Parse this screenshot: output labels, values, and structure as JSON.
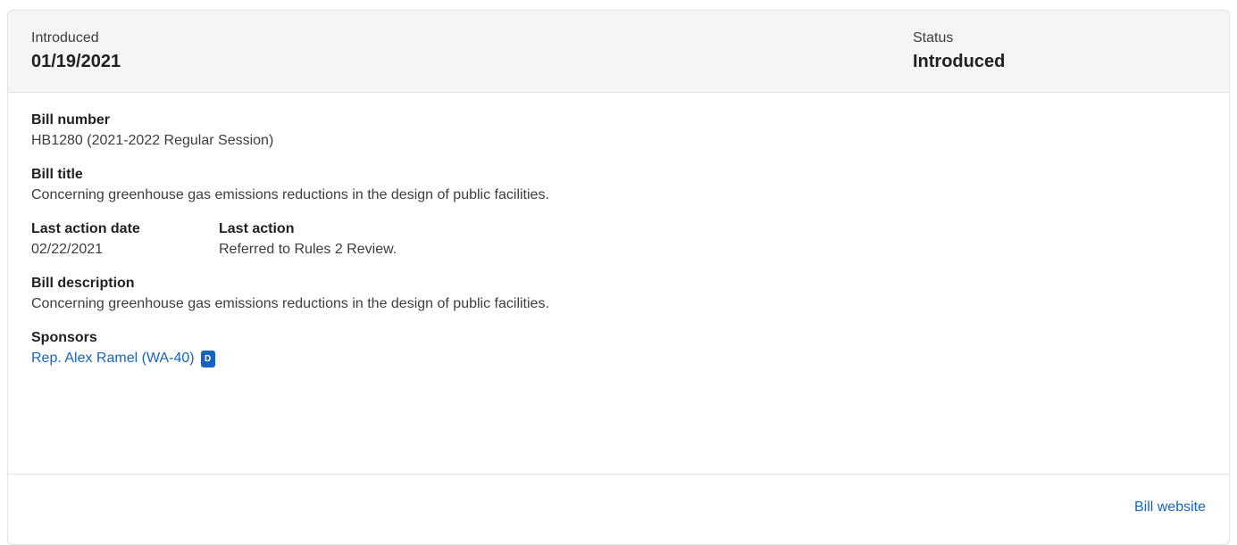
{
  "header": {
    "introduced_label": "Introduced",
    "introduced_value": "01/19/2021",
    "status_label": "Status",
    "status_value": "Introduced"
  },
  "bill": {
    "number_label": "Bill number",
    "number_value": "HB1280 (2021-2022 Regular Session)",
    "title_label": "Bill title",
    "title_value": "Concerning greenhouse gas emissions reductions in the design of public facilities.",
    "last_action_date_label": "Last action date",
    "last_action_date_value": "02/22/2021",
    "last_action_label": "Last action",
    "last_action_value": "Referred to Rules 2 Review.",
    "description_label": "Bill description",
    "description_value": "Concerning greenhouse gas emissions reductions in the design of public facilities.",
    "sponsors_label": "Sponsors",
    "sponsors": [
      {
        "name": "Rep. Alex Ramel (WA-40)",
        "party": "D"
      }
    ]
  },
  "footer": {
    "website_label": "Bill website"
  },
  "colors": {
    "link": "#1565c0",
    "badge_democrat": "#1565c0",
    "header_bg": "#f5f5f5"
  }
}
